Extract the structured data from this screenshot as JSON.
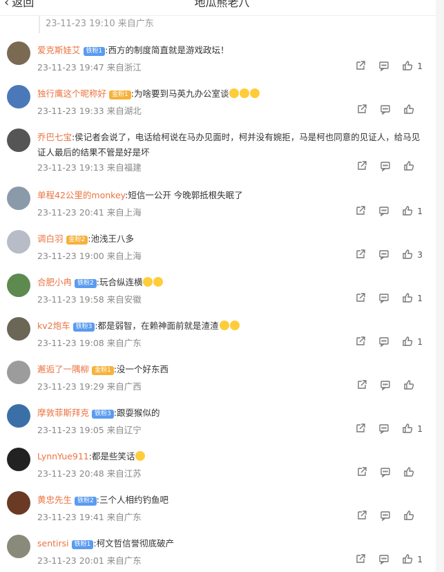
{
  "header": {
    "back_label": "返回",
    "title": "地瓜熊老八"
  },
  "prev_comment": {
    "time": "23-11-23 19:10 来自广东"
  },
  "comments": [
    {
      "name": "爱克斯娃艾",
      "badge": "铁粉1",
      "badge_color": "#5b9bf0",
      "text": ":西方的制度简直就是游戏政坛！",
      "time": "23-11-23 19:47 来自浙江",
      "likes": "1",
      "avatar_color": "#7a6a52"
    },
    {
      "name": "独行鹰这个昵称好",
      "badge": "金粉1",
      "badge_color": "#f6b23c",
      "text": ":为啥要到马英九办公室谈",
      "emoji_count": 3,
      "time": "23-11-23 19:33 来自湖北",
      "likes": "",
      "avatar_color": "#4b78b8"
    },
    {
      "name": "乔巴七宝",
      "badge": "",
      "badge_color": "",
      "text": ":侯记者会说了，电话给柯说在马办见面时，柯并没有婉拒，马是柯也同意的见证人，给马见证人最后的结果不管是好是坏",
      "time": "23-11-23 19:13 来自福建",
      "likes": "",
      "avatar_color": "#555555"
    },
    {
      "name": "单程42公里的monkey",
      "badge": "",
      "badge_color": "",
      "text": ":短信一公开 今晚郭抵根失眠了",
      "time": "23-11-23 20:41 来自上海",
      "likes": "1",
      "avatar_color": "#8a9aa8"
    },
    {
      "name": "调白羽",
      "badge": "金粉2",
      "badge_color": "#f6b23c",
      "text": ":池浅王八多",
      "time": "23-11-23 19:00 来自上海",
      "likes": "3",
      "avatar_color": "#b7bcc6"
    },
    {
      "name": "合肥小冉",
      "badge": "铁粉2",
      "badge_color": "#5b9bf0",
      "text": ":玩合纵连横",
      "emoji_count": 2,
      "time": "23-11-23 19:58 来自安徽",
      "likes": "1",
      "avatar_color": "#5d8a4f"
    },
    {
      "name": "kv2炮车",
      "badge": "铁粉3",
      "badge_color": "#5b9bf0",
      "text": ":都是弱智，在赖神面前就是渣渣",
      "emoji_count": 2,
      "time": "23-11-23 19:08 来自广东",
      "likes": "1",
      "avatar_color": "#6c6657"
    },
    {
      "name": "邂逅了一隅柳",
      "badge": "金粉1",
      "badge_color": "#f6b23c",
      "text": ":没一个好东西",
      "time": "23-11-23 19:29 来自广西",
      "likes": "",
      "avatar_color": "#9c9c9c"
    },
    {
      "name": "摩敦菲斯拜克",
      "badge": "铁粉3",
      "badge_color": "#5b9bf0",
      "text": ":跟耍猴似的",
      "time": "23-11-23 19:05 来自辽宁",
      "likes": "1",
      "avatar_color": "#3b6fa8"
    },
    {
      "name": "LynnYue911",
      "badge": "",
      "badge_color": "",
      "text": ":都是些笑话",
      "emoji_count": 1,
      "time": "23-11-23 20:48 来自江苏",
      "likes": "",
      "avatar_color": "#222222"
    },
    {
      "name": "黄忠先生",
      "badge": "铁粉2",
      "badge_color": "#5b9bf0",
      "text": ":三个人相约钓鱼吧",
      "time": "23-11-23 19:41 来自广东",
      "likes": "",
      "avatar_color": "#6b3a25"
    },
    {
      "name": "sentirsi",
      "badge": "铁粉1",
      "badge_color": "#5b9bf0",
      "text": ":柯文哲信誉彻底破产",
      "time": "23-11-23 20:01 来自广东",
      "likes": "1",
      "avatar_color": "#8a8a7a"
    }
  ]
}
